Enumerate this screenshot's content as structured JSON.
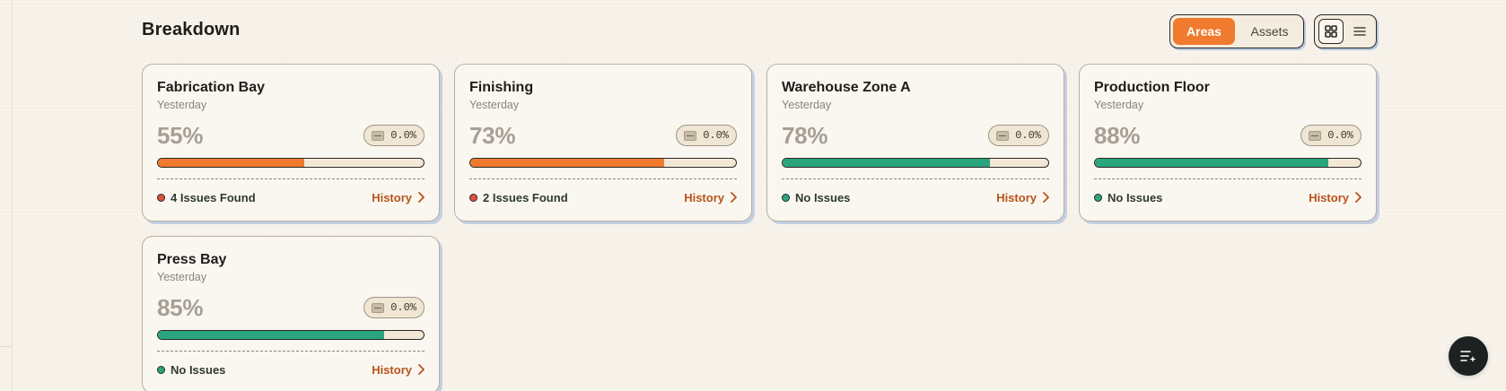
{
  "section": {
    "title": "Breakdown"
  },
  "segmented": {
    "options": [
      "Areas",
      "Assets"
    ],
    "active": "Areas"
  },
  "view_toggle": {
    "active": "grid"
  },
  "colors": {
    "accent": "#f07a2e",
    "good": "#2aa57e",
    "bad": "#e0503a",
    "history": "#b8531a"
  },
  "cards": [
    {
      "name": "Fabrication Bay",
      "date": "Yesterday",
      "percent": "55%",
      "fill": 55,
      "delta": "0.0%",
      "status": "4 Issues Found",
      "status_kind": "bad",
      "link": "History"
    },
    {
      "name": "Finishing",
      "date": "Yesterday",
      "percent": "73%",
      "fill": 73,
      "delta": "0.0%",
      "status": "2 Issues Found",
      "status_kind": "bad",
      "link": "History"
    },
    {
      "name": "Warehouse Zone A",
      "date": "Yesterday",
      "percent": "78%",
      "fill": 78,
      "delta": "0.0%",
      "status": "No Issues",
      "status_kind": "good",
      "link": "History"
    },
    {
      "name": "Production Floor",
      "date": "Yesterday",
      "percent": "88%",
      "fill": 88,
      "delta": "0.0%",
      "status": "No Issues",
      "status_kind": "good",
      "link": "History"
    },
    {
      "name": "Press Bay",
      "date": "Yesterday",
      "percent": "85%",
      "fill": 85,
      "delta": "0.0%",
      "status": "No Issues",
      "status_kind": "good",
      "link": "History"
    }
  ],
  "fab": {
    "icon": "filter-sparkle-icon"
  }
}
